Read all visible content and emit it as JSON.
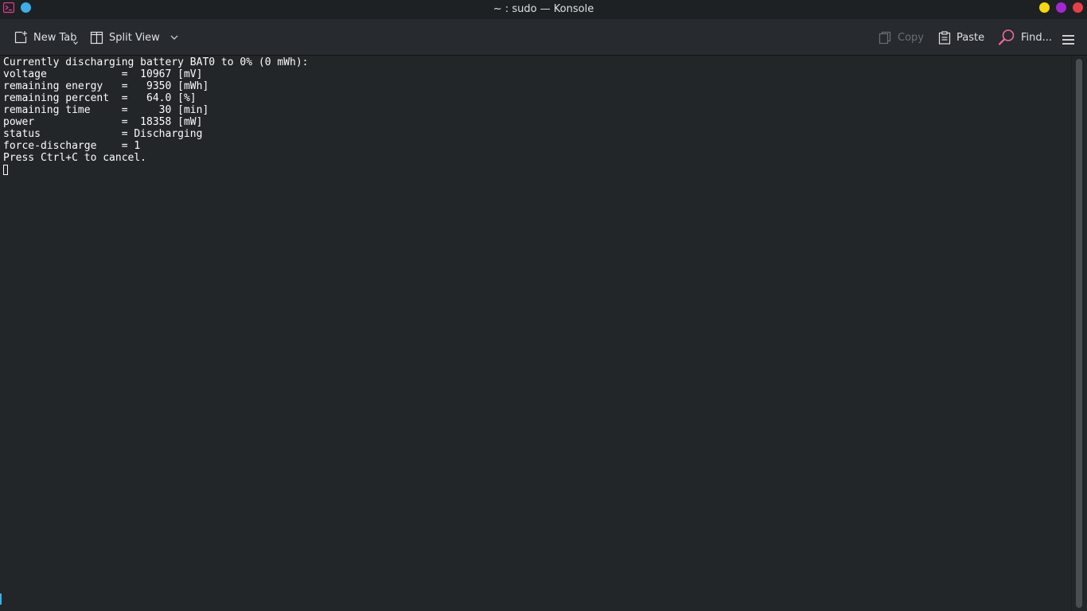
{
  "window": {
    "title": "~ : sudo — Konsole"
  },
  "toolbar": {
    "new_tab_label": "New Tab",
    "split_view_label": "Split View",
    "copy_label": "Copy",
    "paste_label": "Paste",
    "find_label": "Find..."
  },
  "terminal": {
    "lines": [
      "Currently discharging battery BAT0 to 0% (0 mWh):",
      "voltage            =  10967 [mV]",
      "remaining energy   =   9350 [mWh]",
      "remaining percent  =   64.0 [%]",
      "remaining time     =     30 [min]",
      "power              =  18358 [mW]",
      "status             = Discharging",
      "force-discharge    = 1",
      "Press Ctrl+C to cancel."
    ]
  },
  "icons": {
    "app": "konsole-icon",
    "pin": "pin-icon",
    "new_tab": "new-tab-icon",
    "split_view": "split-view-icon",
    "dropdown": "chevron-down-icon",
    "copy": "copy-icon",
    "paste": "paste-icon",
    "find": "find-icon",
    "menu": "hamburger-menu-icon"
  },
  "colors": {
    "background": "#232629",
    "titlebar": "#1e2124",
    "toolbar": "#272a2e",
    "text": "#fcfcfc",
    "accent": "#3daee9",
    "minimize": "#f5d90a",
    "maximize": "#a626d6",
    "close": "#ea3e45"
  }
}
